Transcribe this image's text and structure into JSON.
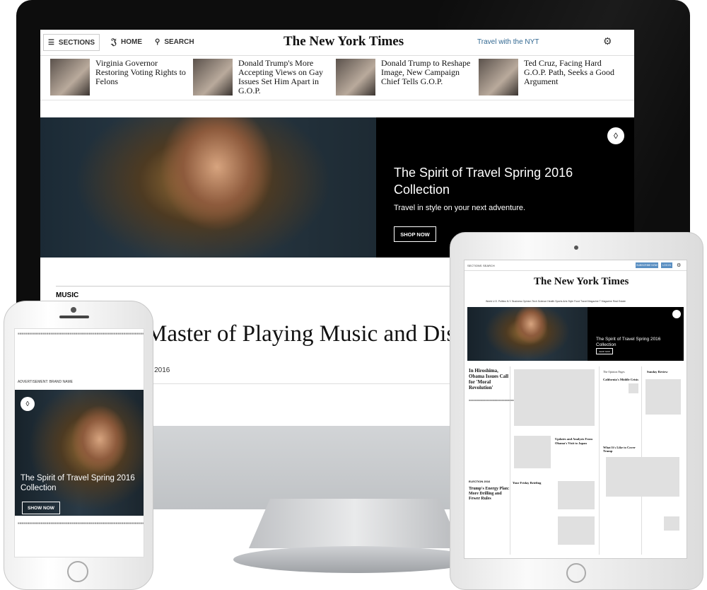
{
  "desktop": {
    "topbar": {
      "sections_label": "SECTIONS",
      "home_label": "HOME",
      "search_label": "SEARCH",
      "logo_text": "The New York Times",
      "travel_link": "Travel with the NYT"
    },
    "stories": [
      {
        "headline": "Virginia Governor Restoring Voting Rights to Felons"
      },
      {
        "headline": "Donald Trump's More Accepting Views on Gay Issues Set Him Apart in G.O.P."
      },
      {
        "headline": "Donald Trump to Reshape Image, New Campaign Chief Tells G.O.P."
      },
      {
        "headline": "Ted Cruz, Facing Hard G.O.P. Path, Seeks a Good Argument"
      }
    ],
    "hero": {
      "title": "The Spirit of Travel Spring 2016 Collection",
      "subtitle": "Travel in style on your next adventure.",
      "cta": "SHOP NOW"
    },
    "article": {
      "kicker": "MUSIC",
      "headline": "Master of Playing Music and Distri",
      "date": "2, 2016"
    }
  },
  "phone": {
    "ad_label": "ADVERTISEMENT: BRAND NAME",
    "hero_title": "The Spirit of Travel Spring 2016 Collection",
    "cta": "SHOW NOW"
  },
  "tablet": {
    "sections_label": "SECTIONS",
    "search_label": "SEARCH",
    "subscribe_label": "SUBSCRIBE NOW",
    "login_label": "LOG IN",
    "logo_text": "The New York Times",
    "nav": "World  U.S.  Politics  N.Y.  Business  Opinion  Tech  Science  Health  Sports  Arts  Style  Food  Travel  Magazine  T Magazine  Real Estate",
    "hero_title": "The Spirit of Travel Spring 2016 Collection",
    "hero_cta": "SHOP NOW",
    "lead_headline": "In Hiroshima, Obama Issues Call for 'Moral Revolution'",
    "updates_headline": "Updates and Analysis From Obama's Visit to Japan",
    "opinion_title": "The Opinion Pages",
    "opinion_headline": "California's Middle Crisis",
    "sunday_review": "Sunday Review",
    "election_label": "ELECTION 2016",
    "election_headline": "Trump's Energy Plan: More Drilling and Fewer Rules",
    "briefing": "Your Friday Briefing",
    "whats_it_like": "What It's Like to Cover Trump"
  },
  "colors": {
    "link_blue": "#326891",
    "subscribe_blue": "#5a8fc2",
    "hero_bg": "#000000"
  }
}
